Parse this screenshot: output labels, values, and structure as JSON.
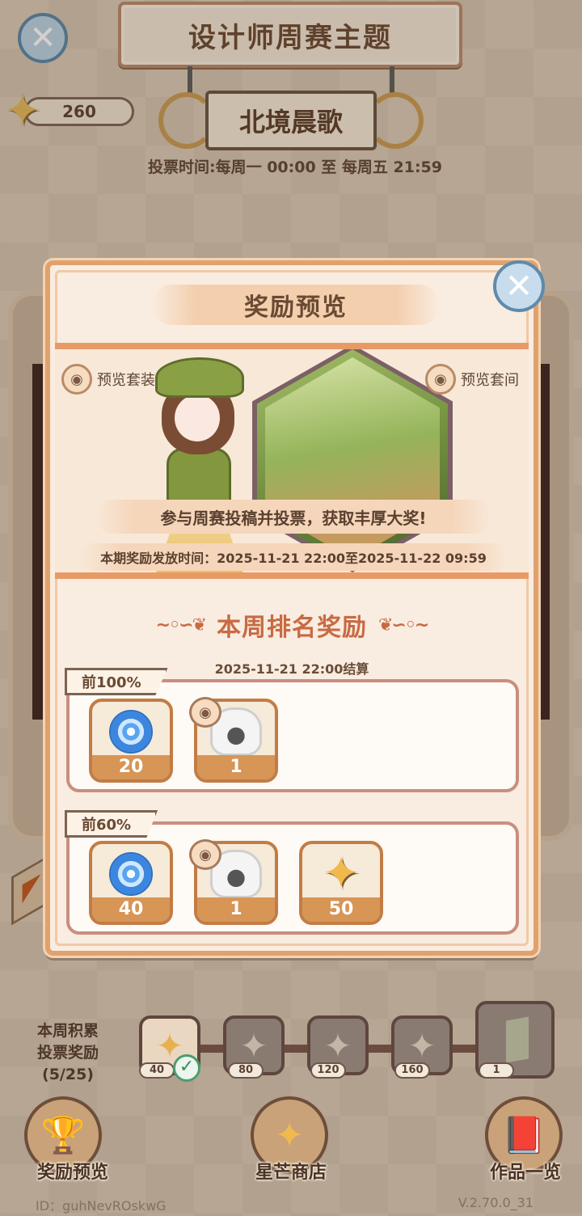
{
  "header": {
    "title": "设计师周赛主题",
    "theme_name": "北境晨歌",
    "vote_time": "投票时间:每周一 00:00 至 每周五 21:59",
    "star_balance": "260"
  },
  "modal": {
    "title": "奖励预览",
    "preview_outfit": "预览套装",
    "preview_room": "预览套间",
    "promo_text": "参与周赛投稿并投票，获取丰厚大奖!",
    "reward_time": "本期奖励发放时间：2025-11-21 22:00至2025-11-22 09:59",
    "rank_title": "本周排名奖励",
    "settle_time": "2025-11-21 22:00结算",
    "tiers": [
      {
        "label": "前100%",
        "items": [
          {
            "icon": "blue-swirl-icon",
            "count": "20"
          },
          {
            "icon": "white-wig-icon",
            "count": "1",
            "previewable": true
          }
        ]
      },
      {
        "label": "前60%",
        "items": [
          {
            "icon": "blue-swirl-icon",
            "count": "40"
          },
          {
            "icon": "white-wig-icon",
            "count": "1",
            "previewable": true
          },
          {
            "icon": "star-icon",
            "count": "50"
          }
        ]
      }
    ]
  },
  "accumulate": {
    "label_line1": "本周积累",
    "label_line2": "投票奖励",
    "progress": "(5/25)",
    "milestones": [
      {
        "value": "40",
        "claimed": true
      },
      {
        "value": "80",
        "claimed": false
      },
      {
        "value": "120",
        "claimed": false
      },
      {
        "value": "160",
        "claimed": false
      },
      {
        "value": "1",
        "claimed": false
      }
    ]
  },
  "nav": {
    "reward_preview": "奖励预览",
    "star_shop": "星芒商店",
    "works_list": "作品一览"
  },
  "footer": {
    "id": "ID：guhNevROskwG",
    "version": "V.2.70.0_31"
  },
  "colors": {
    "accent": "#c86a43",
    "modal_border": "#e0a26d",
    "count_bar": "#d79556"
  }
}
